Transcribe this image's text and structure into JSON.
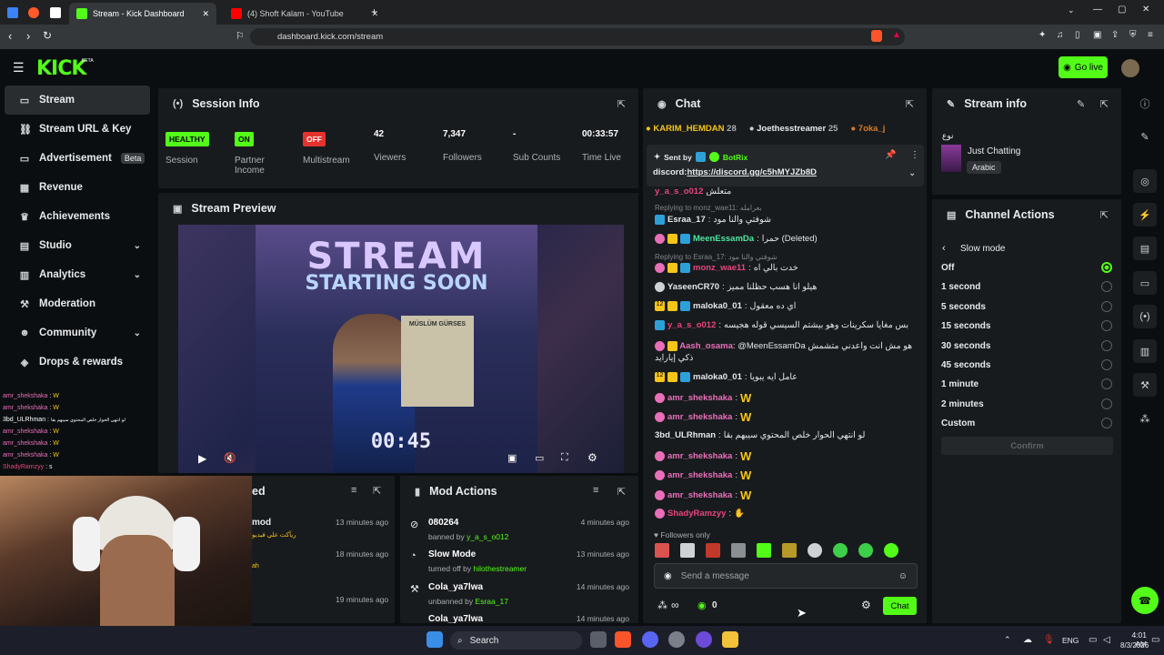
{
  "browser": {
    "tabs": [
      {
        "label": "Stream - Kick Dashboard",
        "active": true
      },
      {
        "label": "(4) Shoft Kalam - YouTube",
        "active": false
      }
    ],
    "url": "dashboard.kick.com/stream"
  },
  "header": {
    "logo": "KICK",
    "beta": "BETA",
    "go_live": "Go live"
  },
  "sidebar": {
    "items": [
      {
        "label": "Stream",
        "icon": "broadcast-icon"
      },
      {
        "label": "Stream URL & Key",
        "icon": "link-icon"
      },
      {
        "label": "Advertisement",
        "icon": "ad-icon",
        "badge": "Beta"
      },
      {
        "label": "Revenue",
        "icon": "revenue-icon"
      },
      {
        "label": "Achievements",
        "icon": "trophy-icon"
      },
      {
        "label": "Studio",
        "icon": "studio-icon"
      },
      {
        "label": "Analytics",
        "icon": "chart-icon"
      },
      {
        "label": "Moderation",
        "icon": "hammer-icon"
      },
      {
        "label": "Community",
        "icon": "community-icon"
      },
      {
        "label": "Drops & rewards",
        "icon": "gift-icon"
      }
    ]
  },
  "session": {
    "title": "Session Info",
    "stats": [
      {
        "value": "HEALTHY",
        "label": "Session"
      },
      {
        "value": "ON",
        "label": "Partner Income"
      },
      {
        "value": "OFF",
        "label": "Multistream"
      },
      {
        "value": "42",
        "label": "Viewers"
      },
      {
        "value": "7,347",
        "label": "Followers"
      },
      {
        "value": "-",
        "label": "Sub Counts"
      },
      {
        "value": "00:33:57",
        "label": "Time Live"
      }
    ]
  },
  "preview": {
    "title": "Stream Preview",
    "line1": "STREAM",
    "line2": "STARTING SOON",
    "timer": "00:45",
    "poster": "MÜSLÜM GÜRSES"
  },
  "recent": {
    "title_tail": "ed",
    "rows": [
      {
        "a": "mod",
        "b": "ريآكت علي فيديو",
        "time": "13 minutes ago"
      },
      {
        "a": "",
        "b": "",
        "time": "18 minutes ago"
      },
      {
        "a": "ah",
        "b": "",
        "time": "19 minutes ago"
      }
    ]
  },
  "modactions": {
    "title": "Mod Actions",
    "rows": [
      {
        "title": "080264",
        "sub": "banned by",
        "user": "y_a_s_o012",
        "time": "4 minutes ago"
      },
      {
        "title": "Slow Mode",
        "sub": "turned off by",
        "user": "hilothestreamer",
        "time": "13 minutes ago"
      },
      {
        "title": "Cola_ya7lwa",
        "sub": "unbanned by",
        "user": "Esraa_17",
        "time": "14 minutes ago"
      },
      {
        "title": "Cola_ya7lwa",
        "sub": "",
        "user": "",
        "time": "14 minutes ago"
      }
    ]
  },
  "chat": {
    "title": "Chat",
    "top": [
      {
        "name": "KARIM_HEMDAN",
        "n": "28"
      },
      {
        "name": "Joethesstreamer",
        "n": "25"
      },
      {
        "name": "7oka_j",
        "n": ""
      }
    ],
    "pinned": {
      "sent_by": "Sent by",
      "bot": "BotRix",
      "text": "discord:",
      "link": "https://discord.gg/c5hMYJZb8D"
    },
    "messages": [
      {
        "reply": "",
        "user": "y_a_s_o012",
        "color": "#e8457c",
        "text": "متعلش"
      },
      {
        "reply": "Replying to monz_wae11: بعرامله",
        "user": "",
        "color": "",
        "text": ""
      },
      {
        "reply": "",
        "user": "Esraa_17",
        "color": "#e8eaec",
        "text": "شوفتي والنا مود"
      },
      {
        "reply": "",
        "user": "MeenEssamDa",
        "color": "#4de8a1",
        "text": "حمرا (Deleted)"
      },
      {
        "reply": "Replying to Esraa_17: شوفتي والنا مود",
        "user": "",
        "color": "",
        "text": ""
      },
      {
        "reply": "",
        "user": "monz_wae11",
        "color": "#e8457c",
        "text": "خدت بالي اه"
      },
      {
        "reply": "",
        "user": "YaseenCR70",
        "color": "#e8eaec",
        "text": "هيلو انا هسب حظلنا مميز"
      },
      {
        "reply": "",
        "user": "maloka0_01",
        "color": "#e8eaec",
        "text": "اي ده معقول"
      },
      {
        "reply": "",
        "user": "y_a_s_o012",
        "color": "#e8457c",
        "text": "بس مغايا سكرينات وهو بيشتم السيسي قوله هجيسه"
      },
      {
        "reply": "",
        "user": "Aash_osama",
        "color": "#e96fb8",
        "text": "@MeenEssamDa هو مش انت واعدني متشمش ذكي إيارايد"
      },
      {
        "reply": "",
        "user": "maloka0_01",
        "color": "#e8eaec",
        "text": "عامل ايه يبويا"
      },
      {
        "reply": "",
        "user": "amr_shekshaka",
        "color": "#e96fb8",
        "text": "W"
      },
      {
        "reply": "",
        "user": "amr_shekshaka",
        "color": "#e96fb8",
        "text": "W"
      },
      {
        "reply": "",
        "user": "3bd_ULRhman",
        "color": "#e8eaec",
        "text": "لو انتهي الحوار خلص المحتوي سيبهم بقا"
      },
      {
        "reply": "",
        "user": "amr_shekshaka",
        "color": "#e96fb8",
        "text": "W"
      },
      {
        "reply": "",
        "user": "amr_shekshaka",
        "color": "#e96fb8",
        "text": "W"
      },
      {
        "reply": "",
        "user": "amr_shekshaka",
        "color": "#e96fb8",
        "text": "W"
      },
      {
        "reply": "",
        "user": "ShadyRamzyy",
        "color": "#e8457c",
        "text": ""
      }
    ],
    "followers_only": "Followers only",
    "placeholder": "Send a message",
    "count": "0",
    "send": "Chat"
  },
  "streaminfo": {
    "title": "Stream info",
    "tag": "نوع",
    "category": "Just Chatting",
    "language": "Arabic"
  },
  "channel": {
    "title": "Channel Actions",
    "submenu": "Slow mode",
    "options": [
      "Off",
      "1 second",
      "5 seconds",
      "15 seconds",
      "30 seconds",
      "45 seconds",
      "1 minute",
      "2 minutes",
      "Custom"
    ],
    "selected": 0,
    "confirm": "Confirm"
  },
  "overlay": [
    {
      "u": "amr_shekshaka",
      "t": "W"
    },
    {
      "u": "amr_shekshaka",
      "t": "W"
    },
    {
      "u": "3bd_ULRhman",
      "t": "لو انتهي الحوار خلص المحتوي سيبهم بقا"
    },
    {
      "u": "amr_shekshaka",
      "t": "W"
    },
    {
      "u": "amr_shekshaka",
      "t": "W"
    },
    {
      "u": "amr_shekshaka",
      "t": "W"
    },
    {
      "u": "ShadyRamzyy",
      "t": "s"
    }
  ],
  "taskbar": {
    "search": "Search",
    "lang": "ENG",
    "time": "4:01 AM",
    "date": "8/3/2026"
  },
  "colors": {
    "accent": "#53fc18",
    "panel": "#181b1e",
    "bg": "#0b0e10"
  }
}
